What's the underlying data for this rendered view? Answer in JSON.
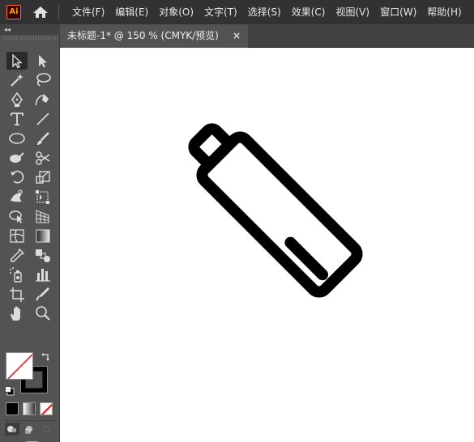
{
  "app": {
    "logo_text": "Ai",
    "home_icon": "home-icon"
  },
  "menu": {
    "items": [
      "文件(F)",
      "编辑(E)",
      "对象(O)",
      "文字(T)",
      "选择(S)",
      "效果(C)",
      "视图(V)",
      "窗口(W)",
      "帮助(H)"
    ]
  },
  "document_tab": {
    "title": "未标题-1* @ 150 % (CMYK/预览)",
    "close_label": "×"
  },
  "toolbar": {
    "collapse_label": "◂◂",
    "tools": [
      "selection-tool",
      "direct-selection-tool",
      "magic-wand-tool",
      "lasso-tool",
      "pen-tool",
      "curvature-tool",
      "type-tool",
      "line-segment-tool",
      "ellipse-tool",
      "paintbrush-tool",
      "shaper-tool",
      "scissors-tool",
      "rotate-tool",
      "scale-tool",
      "puppet-warp-tool",
      "free-transform-tool",
      "shape-builder-tool",
      "perspective-grid-tool",
      "mesh-tool",
      "gradient-tool",
      "eyedropper-tool",
      "blend-tool",
      "symbol-sprayer-tool",
      "column-graph-tool",
      "artboard-tool",
      "slice-tool",
      "hand-tool",
      "zoom-tool"
    ],
    "fill_color": "#ffffff",
    "stroke_color": "#000000"
  },
  "canvas": {
    "background": "#ffffff",
    "artwork": "battery-icon-artwork",
    "stroke_color": "#000000"
  },
  "colors": {
    "accent_logo": "#ff9a00",
    "ui_dark": "#323232",
    "ui_panel": "#535353"
  }
}
